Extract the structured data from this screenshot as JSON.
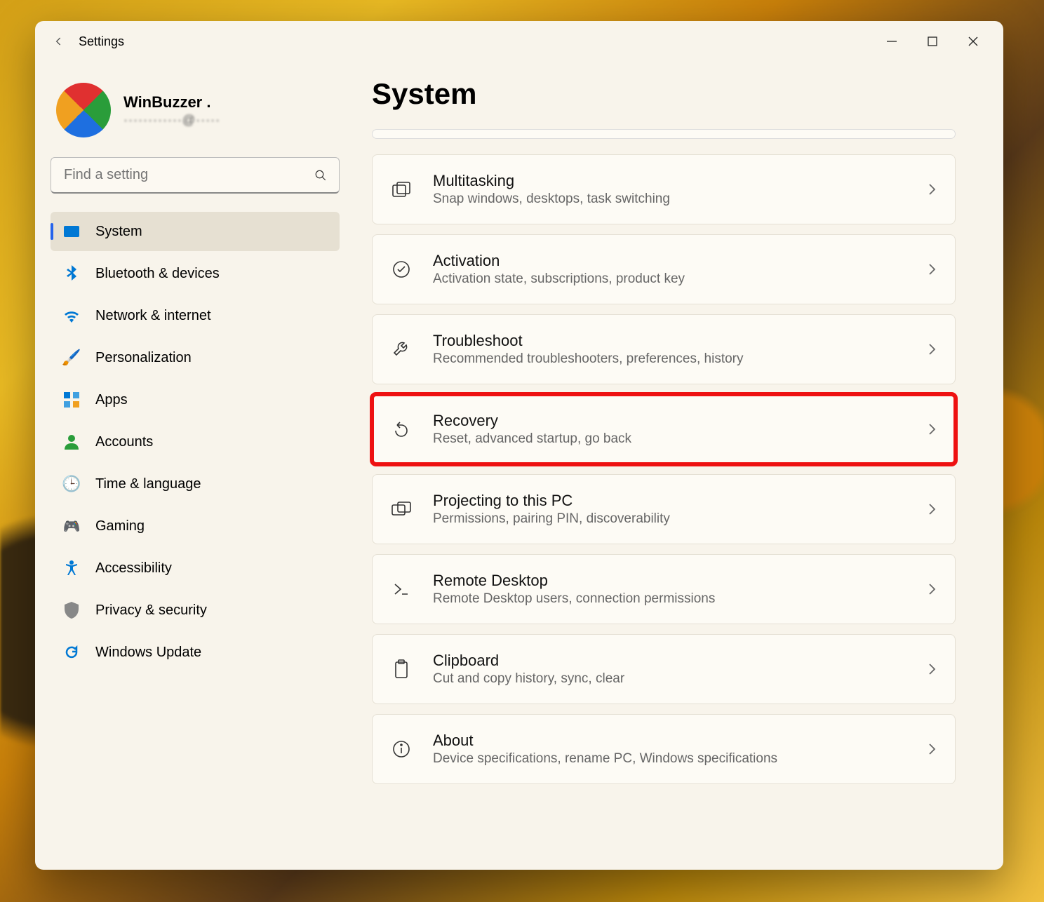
{
  "app_title": "Settings",
  "profile": {
    "name": "WinBuzzer .",
    "email": "············@·····"
  },
  "search": {
    "placeholder": "Find a setting"
  },
  "sidebar": [
    {
      "icon": "🖥️",
      "label": "System",
      "active": true
    },
    {
      "icon": "bt",
      "label": "Bluetooth & devices"
    },
    {
      "icon": "wifi",
      "label": "Network & internet"
    },
    {
      "icon": "🖌️",
      "label": "Personalization"
    },
    {
      "icon": "apps",
      "label": "Apps"
    },
    {
      "icon": "👤",
      "label": "Accounts"
    },
    {
      "icon": "🌐",
      "label": "Time & language"
    },
    {
      "icon": "🎮",
      "label": "Gaming"
    },
    {
      "icon": "acc",
      "label": "Accessibility"
    },
    {
      "icon": "🛡️",
      "label": "Privacy & security"
    },
    {
      "icon": "🔄",
      "label": "Windows Update"
    }
  ],
  "page": {
    "title": "System"
  },
  "cards": [
    {
      "icon": "multitask",
      "title": "Multitasking",
      "sub": "Snap windows, desktops, task switching"
    },
    {
      "icon": "check",
      "title": "Activation",
      "sub": "Activation state, subscriptions, product key"
    },
    {
      "icon": "wrench",
      "title": "Troubleshoot",
      "sub": "Recommended troubleshooters, preferences, history"
    },
    {
      "icon": "recovery",
      "title": "Recovery",
      "sub": "Reset, advanced startup, go back",
      "highlight": true
    },
    {
      "icon": "project",
      "title": "Projecting to this PC",
      "sub": "Permissions, pairing PIN, discoverability"
    },
    {
      "icon": "remote",
      "title": "Remote Desktop",
      "sub": "Remote Desktop users, connection permissions"
    },
    {
      "icon": "clipboard",
      "title": "Clipboard",
      "sub": "Cut and copy history, sync, clear"
    },
    {
      "icon": "info",
      "title": "About",
      "sub": "Device specifications, rename PC, Windows specifications"
    }
  ]
}
